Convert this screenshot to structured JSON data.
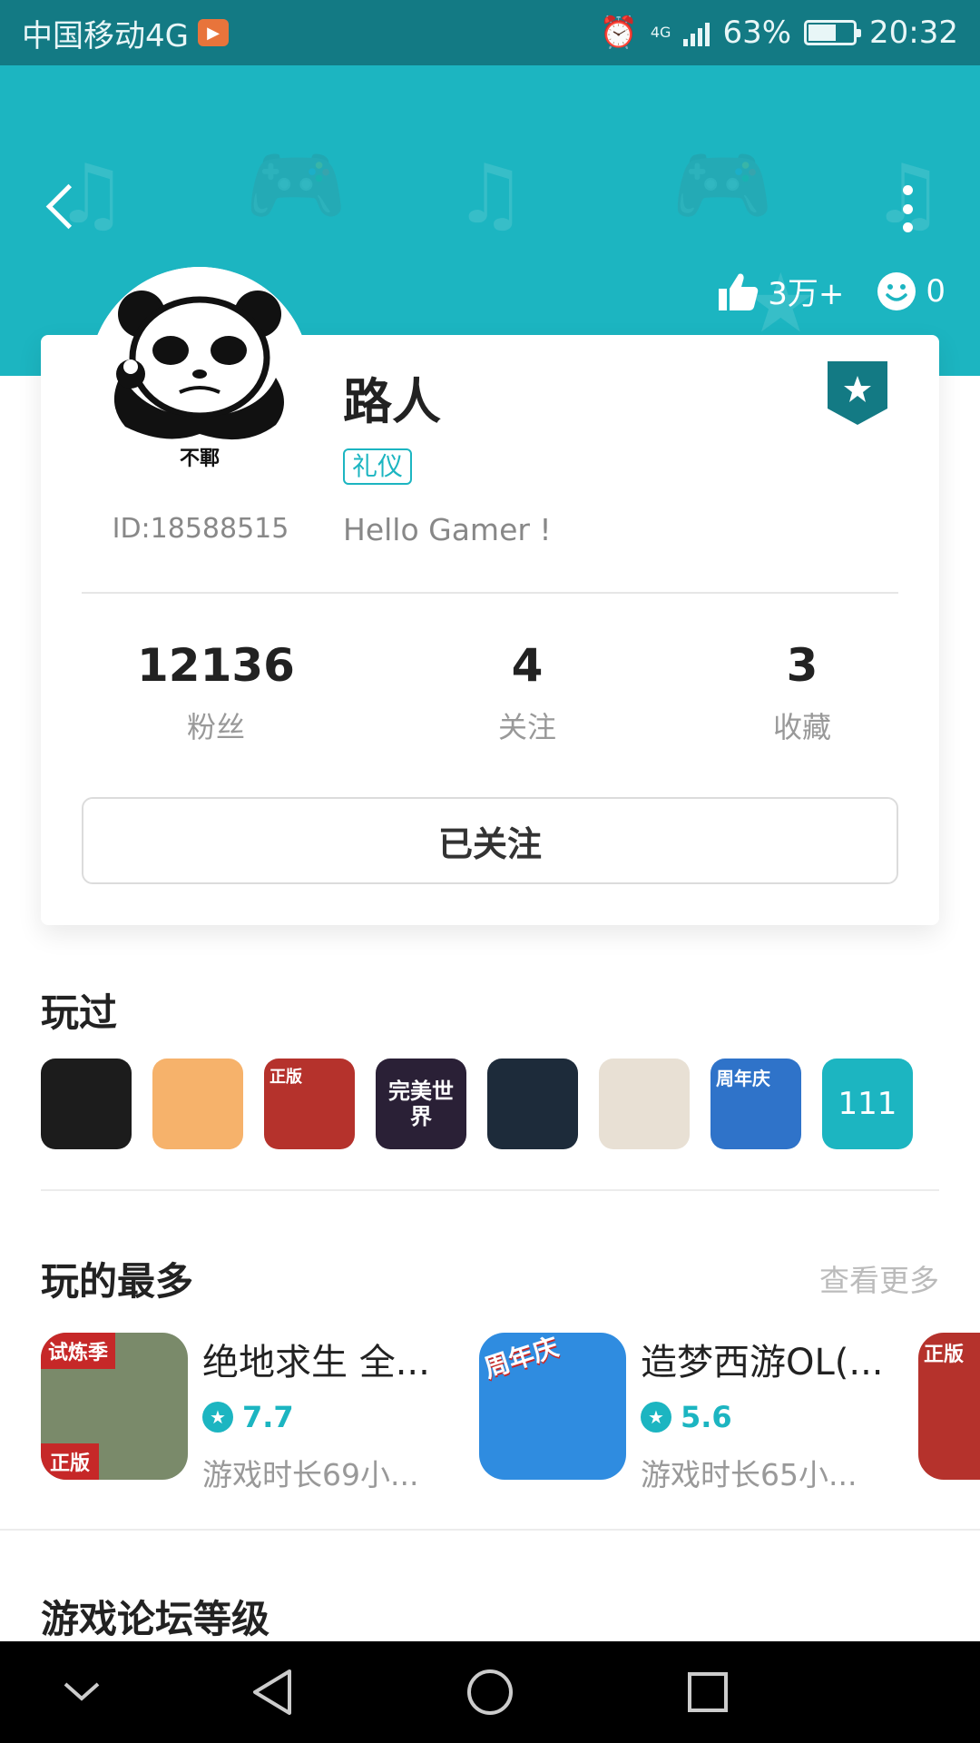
{
  "status_bar": {
    "carrier": "中国移动4G",
    "network": "4G",
    "battery": "63%",
    "battery_level": 0.63,
    "time": "20:32"
  },
  "header": {
    "likes": "3万+",
    "smiles": "0"
  },
  "profile": {
    "avatar_caption": "不鄆",
    "user_id": "ID:18588515",
    "name": "路人",
    "tag": "礼仪",
    "bio": "Hello Gamer !"
  },
  "counts": [
    {
      "value": "12136",
      "label": "粉丝"
    },
    {
      "value": "4",
      "label": "关注"
    },
    {
      "value": "3",
      "label": "收藏"
    }
  ],
  "follow_button": "已关注",
  "played": {
    "title": "玩过",
    "games": [
      {
        "name": "game-1",
        "color": "#1c1c1c",
        "text": ""
      },
      {
        "name": "game-2",
        "color": "#f6b26b",
        "text": ""
      },
      {
        "name": "game-3",
        "color": "#b5322c",
        "text": "正版"
      },
      {
        "name": "game-4",
        "color": "#2a2036",
        "text": "完美世界"
      },
      {
        "name": "game-5",
        "color": "#1d2b3a",
        "text": ""
      },
      {
        "name": "game-6",
        "color": "#e8e0d4",
        "text": ""
      },
      {
        "name": "game-7",
        "color": "#2f73c9",
        "text": "周年庆"
      }
    ],
    "more_count": "111"
  },
  "most_played": {
    "title": "玩的最多",
    "see_more": "查看更多",
    "games": [
      {
        "name": "绝地求生 全...",
        "score": "7.7",
        "time": "游戏时长69小...",
        "badge_top": "试炼季",
        "badge_bottom": "正版",
        "color": "#7a8a6a"
      },
      {
        "name": "造梦西游OL(...",
        "score": "5.6",
        "time": "游戏时长65小...",
        "badge_top": "周年庆",
        "badge_bottom": "",
        "color": "#2f8ce0"
      },
      {
        "name": "",
        "score": "",
        "time": "",
        "badge_top": "正版",
        "badge_bottom": "",
        "color": "#b5322c"
      }
    ]
  },
  "forum": {
    "title": "游戏论坛等级"
  }
}
